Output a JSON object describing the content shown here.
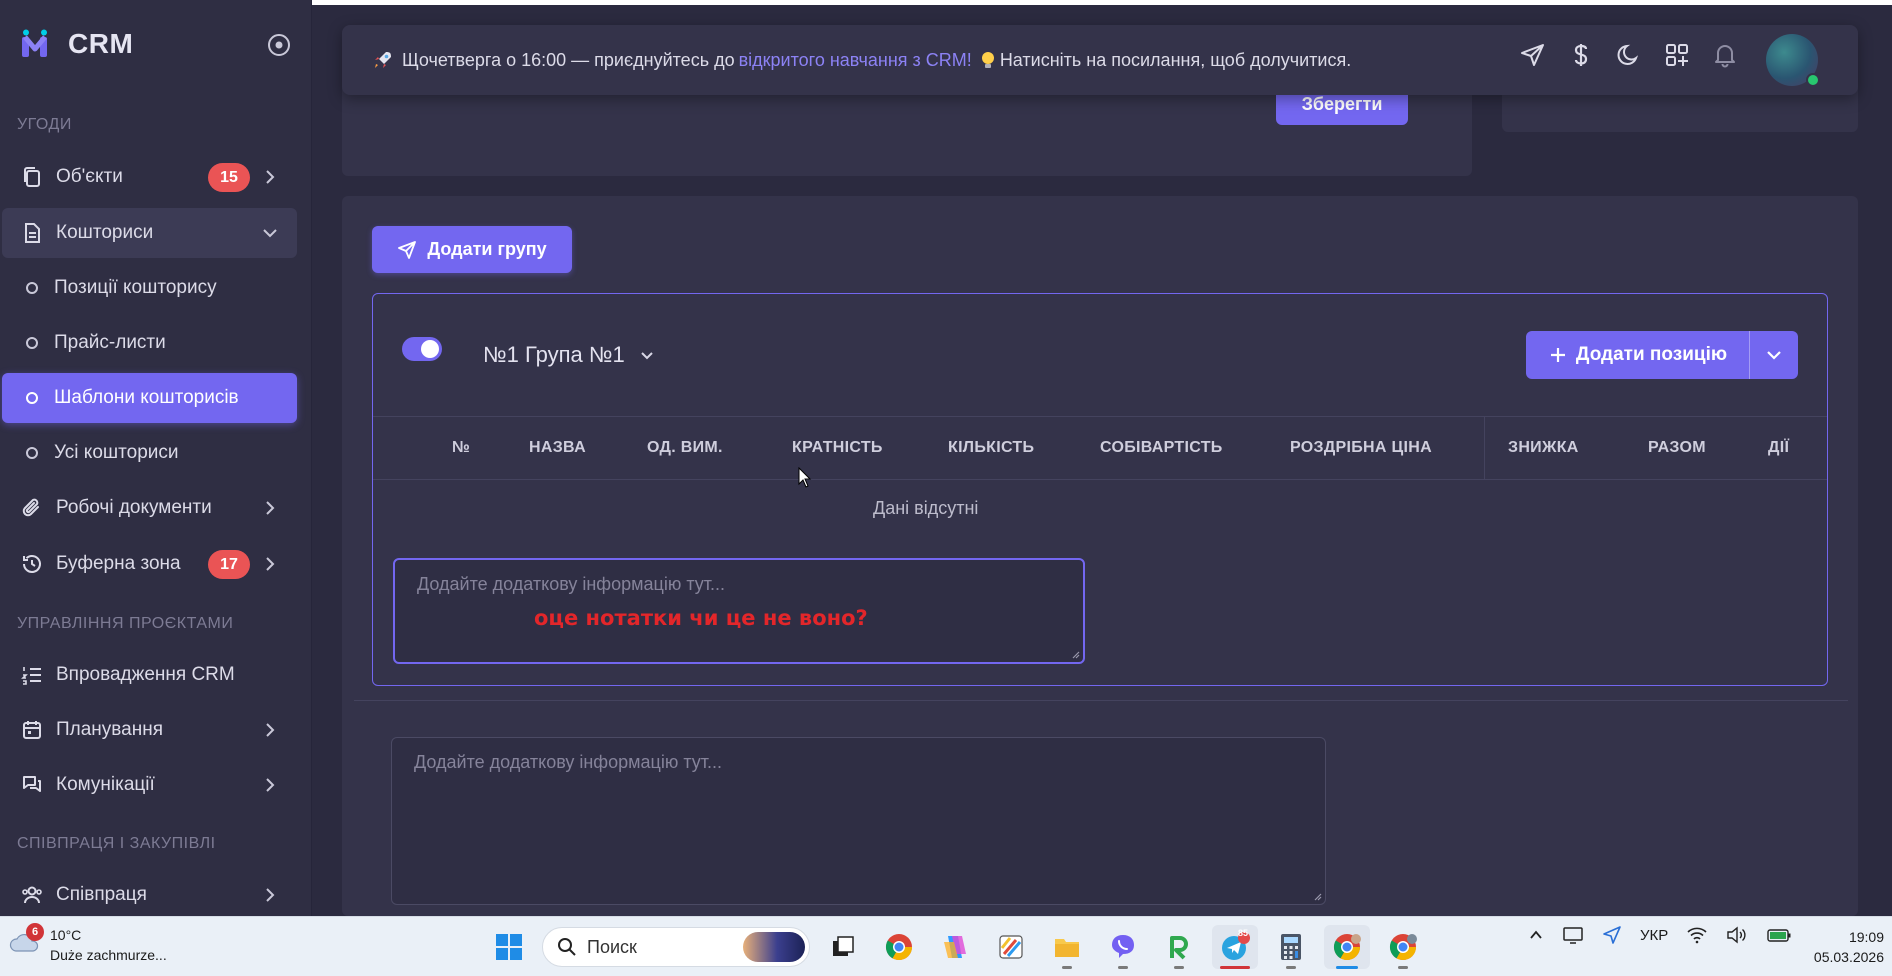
{
  "brand": {
    "name": "CRM"
  },
  "sidebar": {
    "sections": [
      "УГОДИ",
      "УПРАВЛІННЯ ПРОЄКТАМИ",
      "СПІВПРАЦЯ І ЗАКУПІВЛІ"
    ],
    "items": [
      {
        "label": "Об'єкти",
        "badge": "15"
      },
      {
        "label": "Кошториси"
      },
      {
        "label": "Позиції кошторису"
      },
      {
        "label": "Прайс-листи"
      },
      {
        "label": "Шаблони кошторисів"
      },
      {
        "label": "Усі кошториси"
      },
      {
        "label": "Робочі документи"
      },
      {
        "label": "Буферна зона",
        "badge": "17"
      },
      {
        "label": "Впровадження CRM"
      },
      {
        "label": "Планування"
      },
      {
        "label": "Комунікації"
      },
      {
        "label": "Співпраця"
      }
    ]
  },
  "header": {
    "announce_pre": "Щочетверга о 16:00 — приєднуйтесь до",
    "announce_link": "відкритого навчання з CRM!",
    "announce_post": "Натисніть на посилання, щоб долучитися.",
    "icons": [
      "send-icon",
      "dollar-icon",
      "moon-icon",
      "grid-plus-icon",
      "bell-icon"
    ]
  },
  "top_card": {
    "save_label": "Зберегти"
  },
  "main": {
    "add_group_label": "Додати групу",
    "group_title": "№1 Група №1",
    "add_position_label": "Додати позицію",
    "columns": [
      "№",
      "НАЗВА",
      "ОД. ВИМ.",
      "КРАТНІСТЬ",
      "КІЛЬКІСТЬ",
      "СОБІВАРТІСТЬ",
      "РОЗДРІБНА ЦІНА",
      "ЗНИЖКА",
      "РАЗОМ",
      "ДІЇ"
    ],
    "empty_text": "Дані відсутні",
    "note_placeholder": "Додайте додаткову інформацію тут...",
    "annotation": "оце нотатки чи це не воно?",
    "note2_placeholder": "Додайте додаткову інформацію тут..."
  },
  "taskbar": {
    "weather_badge": "6",
    "temperature": "10°C",
    "weather_desc": "Duże zachmurze...",
    "search_label": "Поиск",
    "telegram_badge": "85",
    "language": "УКР",
    "time": "19:09",
    "date": "05.03.2026"
  },
  "colors": {
    "accent": "#7367f0",
    "badge": "#ea5455",
    "annotation": "#e3262a"
  }
}
